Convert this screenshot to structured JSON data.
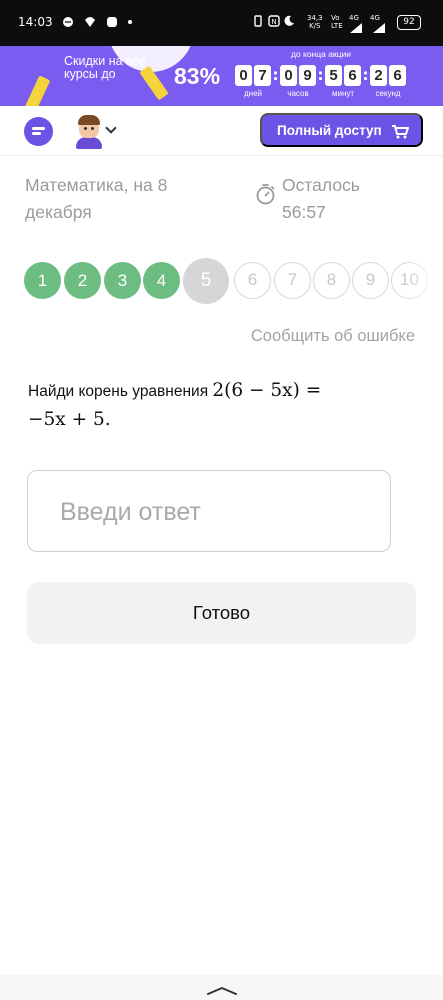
{
  "status_bar": {
    "time": "14:03",
    "speed_value": "34,3",
    "speed_unit": "K/S",
    "net_top": "Vo",
    "net_bottom": "LTE",
    "net_gen": "4G",
    "signal_gen": "4G",
    "battery": "92"
  },
  "banner": {
    "text": "Скидки на все курсы до",
    "percent": "83%",
    "until_label": "до конца акции",
    "timer": [
      {
        "digits": [
          "0",
          "7"
        ],
        "label": "дней"
      },
      {
        "digits": [
          "0",
          "9"
        ],
        "label": "часов"
      },
      {
        "digits": [
          "5",
          "6"
        ],
        "label": "минут"
      },
      {
        "digits": [
          "2",
          "6"
        ],
        "label": "секунд"
      }
    ],
    "bg_color": "#7a5cf0"
  },
  "header": {
    "full_access_label": "Полный доступ",
    "accent_color": "#6d52e6"
  },
  "test": {
    "subject": "Математика, на 8 декабря",
    "remaining_label": "Осталось",
    "remaining_time": "56:57",
    "report_error": "Сообщить об ошибке"
  },
  "progress": {
    "done": [
      "1",
      "2",
      "3",
      "4"
    ],
    "current": "5",
    "todo": [
      "6",
      "7",
      "8",
      "9",
      "10"
    ],
    "done_color": "#6dbd82"
  },
  "question": {
    "prefix": "Найди корень уравнения ",
    "equation_part1": "2(6 − 5x) =",
    "equation_part2": "−5x + 5."
  },
  "answer": {
    "placeholder": "Введи ответ"
  },
  "submit": {
    "label": "Готово"
  }
}
